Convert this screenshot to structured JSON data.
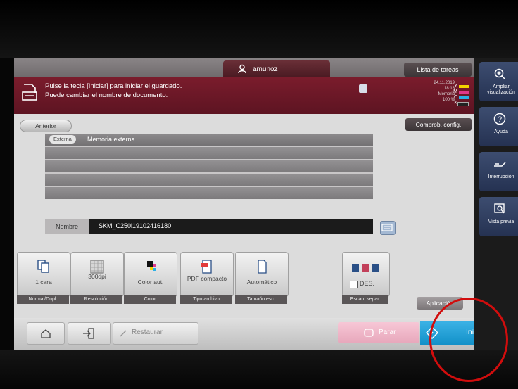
{
  "header": {
    "user_name": "amunoz",
    "jobs_label": "Lista de tareas"
  },
  "message": {
    "line1": "Pulse la tecla [Iniciar] para iniciar el guardado.",
    "line2": "Puede cambiar el nombre de documento."
  },
  "status": {
    "date": "24.11.2019",
    "time": "18:18",
    "memory_label": "Memoria",
    "memory_value": "100 %",
    "toner": [
      "Y",
      "M",
      "C",
      "K"
    ]
  },
  "confirm_label": "Comprob. config.",
  "back_label": "Anterior",
  "destination": {
    "chip": "Externa",
    "label": "Memoria externa"
  },
  "name": {
    "label": "Nombre",
    "value": "SKM_C250i19102416180"
  },
  "functions": [
    {
      "label": "1 cara",
      "sub": "Normal/Dupl."
    },
    {
      "label": "300dpi",
      "sub": "Resolución"
    },
    {
      "label": "Color aut.",
      "sub": "Color"
    },
    {
      "label": "PDF compacto",
      "sub": "Tipo archivo"
    },
    {
      "label": "Automático",
      "sub": "Tamaño esc."
    }
  ],
  "scan_sep": {
    "label": "DES.",
    "sub": "Escan. separ."
  },
  "apply_label": "Aplicación",
  "bottom": {
    "reset_label": "Restaurar",
    "stop_label": "Parar",
    "start_label": "Iniciar"
  },
  "side": [
    {
      "label": "Ampliar visualización",
      "icon": "zoom-in-icon"
    },
    {
      "label": "Ayuda",
      "icon": "help-icon"
    },
    {
      "label": "Interrupción",
      "icon": "interrupt-icon"
    },
    {
      "label": "Vista previa",
      "icon": "preview-icon"
    }
  ],
  "colors": {
    "accent_blue": "#1a9fd8",
    "message_bar": "#6e1828",
    "stop_pink": "#eeb3c6"
  }
}
